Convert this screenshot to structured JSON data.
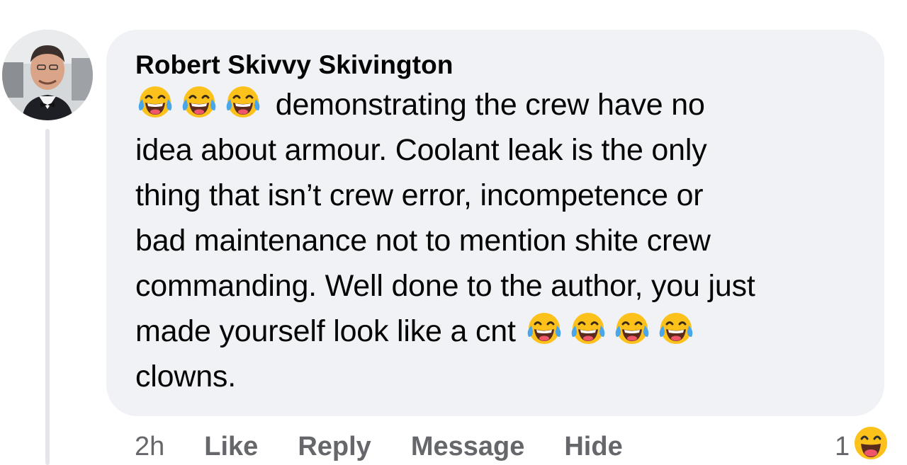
{
  "comment": {
    "author": "Robert Skivvy Skivington",
    "lines": [
      {
        "emojis_before": 3,
        "text": "demonstrating the crew have no",
        "emojis_after": 0
      },
      {
        "emojis_before": 0,
        "text": "idea about armour. Coolant leak is the only",
        "emojis_after": 0
      },
      {
        "emojis_before": 0,
        "text": "thing that isn’t crew error, incompetence or",
        "emojis_after": 0
      },
      {
        "emojis_before": 0,
        "text": "bad maintenance not to mention shite crew",
        "emojis_after": 0
      },
      {
        "emojis_before": 0,
        "text": "commanding. Well done to the author, you just",
        "emojis_after": 0
      },
      {
        "emojis_before": 0,
        "text": "made yourself look like a cnt",
        "emojis_after": 4
      },
      {
        "emojis_before": 0,
        "text": "clowns.",
        "emojis_after": 0
      }
    ],
    "emoji_icon": "face-with-tears-of-joy-icon",
    "timestamp": "2h",
    "actions": {
      "like": "Like",
      "reply": "Reply",
      "message": "Message",
      "hide": "Hide"
    },
    "reactions": {
      "count": "1",
      "icon": "haha-reaction-icon"
    }
  },
  "colors": {
    "bubble": "#f0f2f5",
    "text": "#050505",
    "secondary": "#65676b",
    "emoji_yellow": "#fcc21b",
    "tears": "#4aa6e8"
  }
}
